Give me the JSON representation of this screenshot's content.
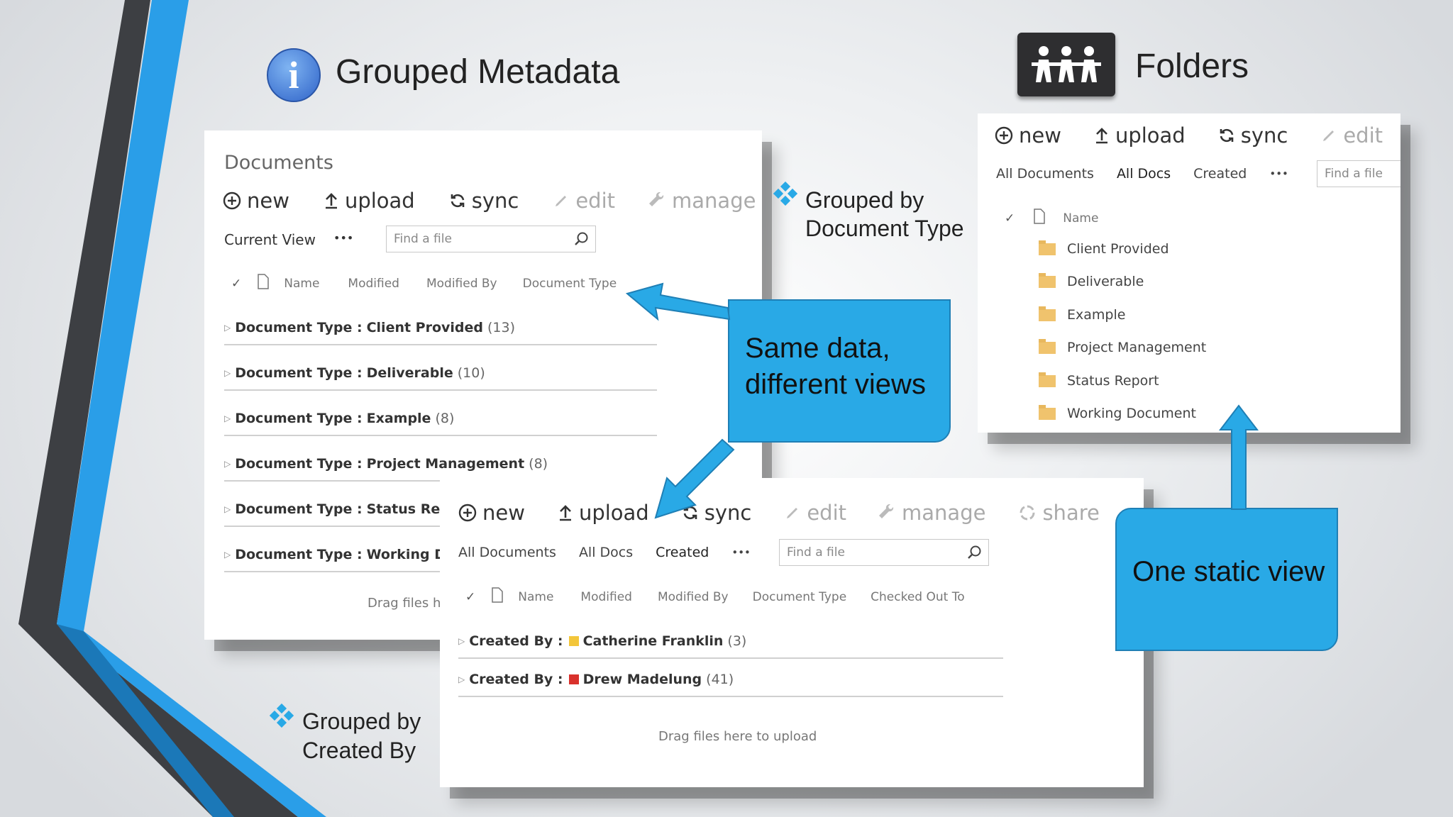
{
  "slide": {
    "left_title": "Grouped Metadata",
    "right_title": "Folders",
    "caption_doc_type_line1": "Grouped by",
    "caption_doc_type_line2": "Document Type",
    "caption_created_line1": "Grouped by",
    "caption_created_line2": "Created By",
    "callout_same": "Same data, different views",
    "callout_static": "One static view"
  },
  "colors": {
    "accent_blue": "#29a9e6",
    "stripe_dark": "#3d3f43",
    "stripe_blue": "#1e8fd8",
    "folder": "#f0c36d"
  },
  "panel_left": {
    "title": "Documents",
    "toolbar": {
      "new": "new",
      "upload": "upload",
      "sync": "sync",
      "edit": "edit",
      "manage": "manage"
    },
    "current_view": "Current View",
    "ellipsis": "•••",
    "search_placeholder": "Find a file",
    "columns": {
      "name": "Name",
      "modified": "Modified",
      "modified_by": "Modified By",
      "doc_type": "Document Type"
    },
    "groups": [
      {
        "label": "Document Type :",
        "value": "Client Provided",
        "count": "(13)"
      },
      {
        "label": "Document Type :",
        "value": "Deliverable",
        "count": "(10)"
      },
      {
        "label": "Document Type :",
        "value": "Example",
        "count": "(8)"
      },
      {
        "label": "Document Type :",
        "value": "Project Management",
        "count": "(8)"
      },
      {
        "label": "Document Type :",
        "value": "Status Repo",
        "count": ""
      },
      {
        "label": "Document Type :",
        "value": "Working Do",
        "count": ""
      }
    ],
    "drag": "Drag files he"
  },
  "panel_right": {
    "toolbar": {
      "new": "new",
      "upload": "upload",
      "sync": "sync",
      "edit": "edit"
    },
    "views": {
      "all_documents": "All Documents",
      "all_docs": "All Docs",
      "created": "Created",
      "ellipsis": "•••"
    },
    "search_placeholder": "Find a file",
    "columns": {
      "name": "Name"
    },
    "folders": [
      "Client Provided",
      "Deliverable",
      "Example",
      "Project Management",
      "Status Report",
      "Working Document"
    ]
  },
  "panel_bottom": {
    "toolbar": {
      "new": "new",
      "upload": "upload",
      "sync": "sync",
      "edit": "edit",
      "manage": "manage",
      "share": "share"
    },
    "views": {
      "all_documents": "All Documents",
      "all_docs": "All Docs",
      "created": "Created",
      "ellipsis": "•••"
    },
    "search_placeholder": "Find a file",
    "columns": {
      "name": "Name",
      "modified": "Modified",
      "modified_by": "Modified By",
      "doc_type": "Document Type",
      "checked_out": "Checked Out To"
    },
    "groups": [
      {
        "label": "Created By :",
        "value": "Catherine Franklin",
        "count": "(3)"
      },
      {
        "label": "Created By :",
        "value": "Drew Madelung",
        "count": "(41)"
      }
    ],
    "drag": "Drag files here to upload"
  }
}
